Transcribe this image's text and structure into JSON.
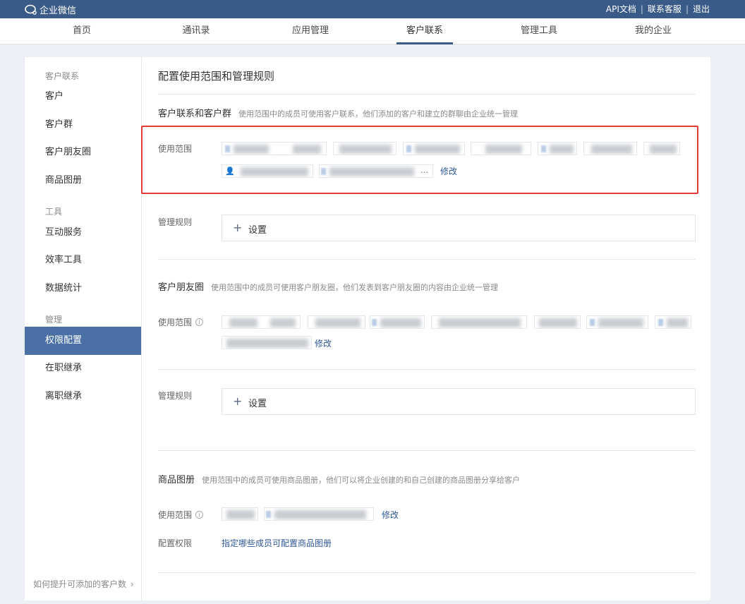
{
  "topbar": {
    "brand": "企业微信",
    "links": [
      "API文档",
      "联系客服",
      "退出"
    ],
    "separator": "|",
    "bg_color": "#3a5a87"
  },
  "nav": {
    "tabs": [
      "首页",
      "通讯录",
      "应用管理",
      "客户联系",
      "管理工具",
      "我的企业"
    ],
    "active_index": 3
  },
  "sidebar": {
    "groups": [
      {
        "title": "客户联系",
        "items": [
          "客户",
          "客户群",
          "客户朋友圈",
          "商品图册"
        ]
      },
      {
        "title": "工具",
        "items": [
          "互动服务",
          "效率工具",
          "数据统计"
        ]
      },
      {
        "title": "管理",
        "items": [
          "权限配置",
          "在职继承",
          "离职继承"
        ]
      }
    ],
    "active_item": "权限配置",
    "footer": "如何提升可添加的客户数",
    "footer_icon": "chevron-right-icon"
  },
  "content": {
    "title": "配置使用范围和管理规则",
    "sections": [
      {
        "title": "客户联系和客户群",
        "desc": "使用范围中的成员可使用客户联系，他们添加的客户和建立的群聊由企业统一管理",
        "scope_label": "使用范围",
        "scope_tail": "…",
        "edit": "修改",
        "rule_label": "管理规则",
        "rule_button": "设置"
      },
      {
        "title": "客户朋友圈",
        "desc": "使用范围中的成员可使用客户朋友圈，他们发表到客户朋友圈的内容由企业统一管理",
        "scope_label": "使用范围",
        "edit": "修改",
        "rule_label": "管理规则",
        "rule_button": "设置"
      },
      {
        "title": "商品图册",
        "desc": "使用范围中的成员可使用商品图册，他们可以将企业创建的和自己创建的商品图册分享给客户",
        "scope_label": "使用范围",
        "edit": "修改",
        "perm_label": "配置权限",
        "perm_link": "指定哪些成员可配置商品图册"
      }
    ]
  },
  "colors": {
    "accent": "#3a5a87",
    "sidebar_active": "#4a70a6",
    "link": "#2f5896",
    "highlight": "#e53935"
  }
}
